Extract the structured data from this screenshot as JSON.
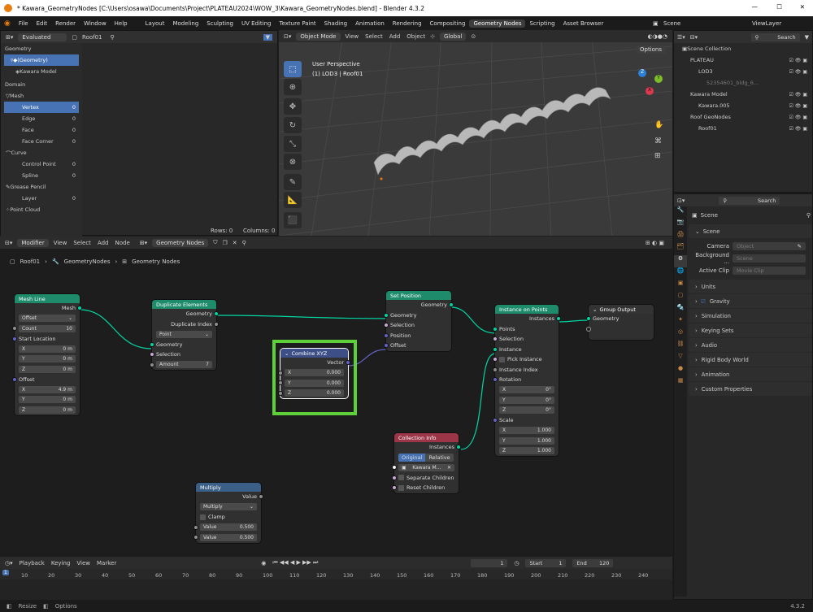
{
  "window": {
    "title": "* Kawara_GeometryNodes [C:\\Users\\osawa\\Documents\\Project\\PLATEAU2024\\WOW_3\\Kawara_GeometryNodes.blend] - Blender 4.3.2",
    "min": "—",
    "max": "☐",
    "close": "✕"
  },
  "menu": [
    "File",
    "Edit",
    "Render",
    "Window",
    "Help"
  ],
  "workspaces": [
    "Layout",
    "Modeling",
    "Sculpting",
    "UV Editing",
    "Texture Paint",
    "Shading",
    "Animation",
    "Rendering",
    "Compositing",
    "Geometry Nodes",
    "Scripting",
    "Asset Browser"
  ],
  "active_workspace": "Geometry Nodes",
  "scene_name": "Scene",
  "view_layer": "ViewLayer",
  "spreadsheet": {
    "mode": "Evaluated",
    "object": "Roof01",
    "geometry_label": "Geometry",
    "geometry_item": "(Geometry)",
    "model_item": "Kawara Model",
    "domain_label": "Domain",
    "mesh": "Mesh",
    "mesh_items": [
      {
        "label": "Vertex",
        "count": "0"
      },
      {
        "label": "Edge",
        "count": "0"
      },
      {
        "label": "Face",
        "count": "0"
      },
      {
        "label": "Face Corner",
        "count": "0"
      }
    ],
    "curve": "Curve",
    "curve_items": [
      {
        "label": "Control Point",
        "count": "0"
      },
      {
        "label": "Spline",
        "count": "0"
      }
    ],
    "grease": "Grease Pencil",
    "grease_items": [
      {
        "label": "Layer",
        "count": "0"
      }
    ],
    "pointcloud": "Point Cloud",
    "rows": "Rows: 0",
    "columns": "Columns: 0"
  },
  "viewport": {
    "mode": "Object Mode",
    "menus": [
      "View",
      "Select",
      "Add",
      "Object"
    ],
    "orientation": "Global",
    "options": "Options",
    "perspective": "User Perspective",
    "context": "(1) LOD3 | Roof01",
    "axes": {
      "x": "X",
      "y": "Y",
      "z": "Z"
    }
  },
  "outliner": {
    "search": "Search",
    "root": "Scene Collection",
    "items": [
      {
        "label": "PLATEAU",
        "level": 1
      },
      {
        "label": "LOD3",
        "level": 2
      },
      {
        "label": "52354601_bldg_6...",
        "level": 3
      },
      {
        "label": "Kawara Model",
        "level": 1
      },
      {
        "label": "Kawara.005",
        "level": 2
      },
      {
        "label": "Roof GeoNodes",
        "level": 1
      },
      {
        "label": "Roof01",
        "level": 2
      }
    ]
  },
  "properties": {
    "search": "Search",
    "scene_title": "Scene",
    "scene_section": "Scene",
    "camera_label": "Camera",
    "camera_value": "Object",
    "background_label": "Background ...",
    "background_value": "Scene",
    "clip_label": "Active Clip",
    "clip_value": "Movie Clip",
    "sections": [
      "Units",
      "Gravity",
      "Simulation",
      "Keying Sets",
      "Audio",
      "Rigid Body World",
      "Animation",
      "Custom Properties"
    ]
  },
  "node_editor": {
    "editor": "Modifier",
    "menus": [
      "View",
      "Select",
      "Add",
      "Node"
    ],
    "tree": "Geometry Nodes",
    "breadcrumb": [
      "Roof01",
      "GeometryNodes",
      "Geometry Nodes"
    ],
    "nodes": {
      "mesh_line": {
        "title": "Mesh Line",
        "out": "Mesh",
        "mode": "Offset",
        "count_label": "Count",
        "count": "10",
        "start": "Start Location",
        "x": "0 m",
        "y": "0 m",
        "z": "0 m",
        "offset": "Offset",
        "ox": "4.9 m",
        "oy": "0 m",
        "oz": "0 m"
      },
      "duplicate": {
        "title": "Duplicate Elements",
        "out1": "Geometry",
        "out2": "Duplicate Index",
        "domain": "Point",
        "in1": "Geometry",
        "in2": "Selection",
        "amount_label": "Amount",
        "amount": "7"
      },
      "combine": {
        "title": "Combine XYZ",
        "out": "Vector",
        "x": "0.000",
        "y": "0.000",
        "z": "0.000"
      },
      "set_position": {
        "title": "Set Position",
        "out": "Geometry",
        "in1": "Geometry",
        "in2": "Selection",
        "in3": "Position",
        "in4": "Offset"
      },
      "instance": {
        "title": "Instance on Points",
        "out": "Instances",
        "points": "Points",
        "selection": "Selection",
        "instance": "Instance",
        "pick": "Pick Instance",
        "index": "Instance Index",
        "rotation": "Rotation",
        "rx": "0°",
        "ry": "0°",
        "rz": "0°",
        "scale": "Scale",
        "sx": "1.000",
        "sy": "1.000",
        "sz": "1.000"
      },
      "group_output": {
        "title": "Group Output",
        "in": "Geometry"
      },
      "collection": {
        "title": "Collection Info",
        "out": "Instances",
        "original": "Original",
        "relative": "Relative",
        "coll": "Kawara M...",
        "sep": "Separate Children",
        "reset": "Reset Children"
      },
      "multiply": {
        "title": "Multiply",
        "out": "Value",
        "op": "Multiply",
        "clamp": "Clamp",
        "v1_label": "Value",
        "v1": "0.500",
        "v2_label": "Value",
        "v2": "0.500"
      }
    }
  },
  "timeline": {
    "menus": [
      "Playback",
      "Keying",
      "View",
      "Marker"
    ],
    "frame": "1",
    "start_label": "Start",
    "start": "1",
    "end_label": "End",
    "end": "120",
    "ticks": [
      "10",
      "20",
      "30",
      "40",
      "50",
      "60",
      "70",
      "80",
      "90",
      "100",
      "110",
      "120",
      "130",
      "140",
      "150",
      "160",
      "170",
      "180",
      "190",
      "200",
      "210",
      "220",
      "230",
      "240"
    ],
    "current": "1"
  },
  "status": {
    "resize": "Resize",
    "options": "Options",
    "version": "4.3.2"
  }
}
